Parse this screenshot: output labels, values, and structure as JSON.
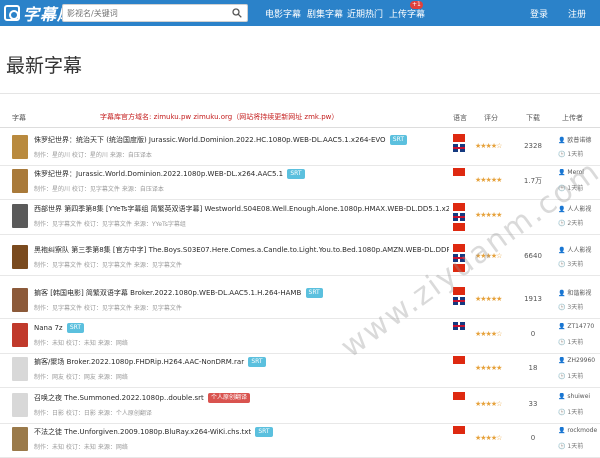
{
  "brand": {
    "logo_text": "字幕库"
  },
  "search": {
    "placeholder": "影视名/关键词"
  },
  "nav": {
    "items": [
      {
        "label": "电影字幕"
      },
      {
        "label": "剧集字幕"
      },
      {
        "label": "近期热门"
      },
      {
        "label": "上传字幕"
      },
      {
        "label": "登录"
      },
      {
        "label": "注册"
      }
    ],
    "upload_badge": "+1"
  },
  "page": {
    "title": "最新字幕"
  },
  "table": {
    "headers": [
      "字幕",
      "语言",
      "评分",
      "下载",
      "上传者"
    ],
    "notice": "字幕库官方域名: zimuku.pw zimuku.org（网站将持续更新网址 zmk.pw）",
    "rows": [
      {
        "title": "侏罗纪世界：统治天下 (统治国度版) Jurassic.World.Dominion.2022.HC.1080p.WEB-DL.AAC5.1.x264-EVO",
        "format": "SRT",
        "extra_tag": "",
        "meta": "制作：星的川  校订：星的川  来源：自压译本",
        "flags": [
          "cn",
          "uk"
        ],
        "rating": 4,
        "downloads": "2328",
        "uploader": "欧普诺德",
        "date": "1天前",
        "thumb_color": "#b98a3e"
      },
      {
        "title": "侏罗纪世界：Jurassic.World.Dominion.2022.1080p.WEB-DL.x264.AAC5.1",
        "format": "SRT",
        "extra_tag": "",
        "meta": "制作：星的川  校订：见字幕文件  来源：自压译本",
        "flags": [
          "cn"
        ],
        "rating": 5,
        "downloads": "1.7万",
        "uploader": "Merol",
        "date": "1天前",
        "thumb_color": "#a97a3a"
      },
      {
        "title": "西部世界 第四季第8集 [YYeTs字幕组 简繁英双语字幕] Westworld.S04E08.Well.Enough.Alone.1080p.HMAX.WEB-DL.DD5.1.x264-NTb.zip",
        "format": "SRT",
        "extra_tag": "YYeTs字幕组",
        "meta": "制作：见字幕文件  校订：见字幕文件  来源：YYeTs字幕组",
        "flags": [
          "cn",
          "uk",
          "cn"
        ],
        "rating": 5,
        "downloads": "",
        "uploader": "人人影视",
        "date": "2天前",
        "thumb_color": "#5a5a5a"
      },
      {
        "title": "黑袍纠察队 第三季第8集 [官方中字] The.Boys.S03E07.Here.Comes.a.Candle.to.Light.You.to.Bed.1080p.AMZN.WEB-DL.DDP5.1.H264-NTb.zip",
        "format": "",
        "extra_tag": "",
        "meta": "制作：见字幕文件  校订：见字幕文件  来源：见字幕文件",
        "flags": [
          "cn",
          "uk",
          "cn"
        ],
        "rating": 4,
        "downloads": "6640",
        "uploader": "人人影视",
        "date": "3天前",
        "thumb_color": "#7a4a1e"
      },
      {
        "title": "掮客 [韩国电影] 简繁双语字幕 Broker.2022.1080p.WEB-DL.AAC5.1.H.264-HAMB",
        "format": "SRT",
        "extra_tag": "",
        "meta": "制作：见字幕文件  校订：见字幕文件  来源：见字幕文件",
        "flags": [
          "cn",
          "uk"
        ],
        "rating": 5,
        "downloads": "1913",
        "uploader": "和谐影视",
        "date": "3天前",
        "thumb_color": "#8c5a3a"
      },
      {
        "title": "Nana 7z",
        "format": "SRT",
        "extra_tag": "",
        "meta": "制作：未知  校订：未知  来源：网络",
        "flags": [
          "uk"
        ],
        "rating": 4,
        "downloads": "0",
        "uploader": "ZT14770",
        "date": "1天前",
        "thumb_color": "#c0392b"
      },
      {
        "title": "掮客/聚场 Broker.2022.1080p.FHDRip.H264.AAC-NonDRM.rar",
        "format": "SRT",
        "extra_tag": "",
        "meta": "制作：网友  校订：网友  来源：网络",
        "flags": [
          "cn"
        ],
        "rating": 5,
        "downloads": "18",
        "uploader": "ZH29960",
        "date": "1天前",
        "thumb_color": "#d8d8d8"
      },
      {
        "title": "召唤之夜 The.Summoned.2022.1080p..double.srt",
        "format": "",
        "extra_tag": "个人原创翻译",
        "meta": "制作：日影  校订：日影  来源：个人原创翻译",
        "flags": [
          "cn"
        ],
        "rating": 4,
        "downloads": "33",
        "uploader": "shuiwei",
        "date": "1天前",
        "thumb_color": "#d8d8d8"
      },
      {
        "title": "不法之徒 The.Unforgiven.2009.1080p.BluRay.x264-WiKi.chs.txt",
        "format": "SRT",
        "extra_tag": "",
        "meta": "制作：未知  校订：未知  来源：网络",
        "flags": [
          "cn"
        ],
        "rating": 4,
        "downloads": "0",
        "uploader": "rockmode",
        "date": "1天前",
        "thumb_color": "#9a7a4a"
      }
    ]
  },
  "watermark": "www.ziyuanm.com"
}
